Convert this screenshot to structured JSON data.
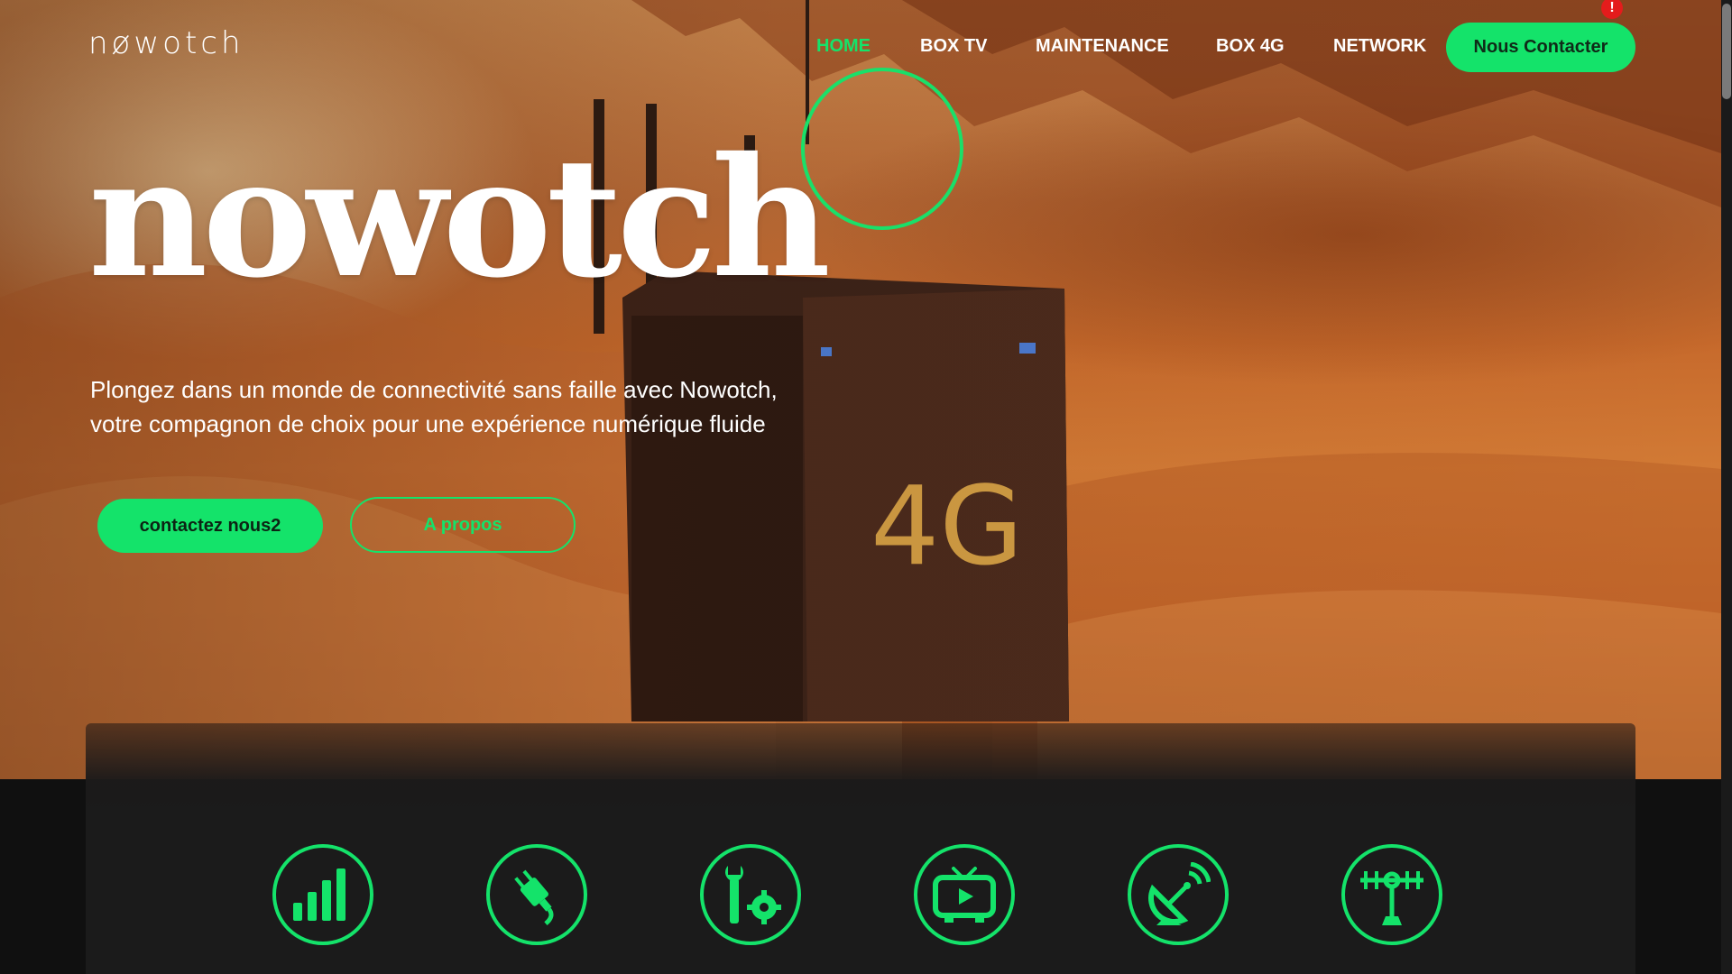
{
  "brand": {
    "logo_text": "nøwotch"
  },
  "nav": {
    "items": [
      {
        "label": "HOME",
        "active": true
      },
      {
        "label": "BOX TV",
        "active": false
      },
      {
        "label": "MAINTENANCE",
        "active": false
      },
      {
        "label": "BOX 4G",
        "active": false
      },
      {
        "label": "NETWORK",
        "active": false
      }
    ],
    "contact_label": "Nous Contacter",
    "alert_badge": "!"
  },
  "hero": {
    "title": "nowotch",
    "device_label": "4G",
    "tagline_line1": "Plongez dans un monde de connectivité sans faille avec Nowotch,",
    "tagline_line2": "votre compagnon de choix pour une expérience numérique fluide",
    "primary_button": "contactez nous2",
    "secondary_button": "A propos"
  },
  "services": [
    {
      "icon": "signal-bars-icon"
    },
    {
      "icon": "plug-icon"
    },
    {
      "icon": "tools-gear-icon"
    },
    {
      "icon": "tv-play-icon"
    },
    {
      "icon": "satellite-dish-icon"
    },
    {
      "icon": "antenna-icon"
    }
  ],
  "colors": {
    "accent": "#14e36a",
    "alert": "#e41c1c",
    "dark_panel": "#1b1b1b",
    "footer_bg": "#101010"
  }
}
